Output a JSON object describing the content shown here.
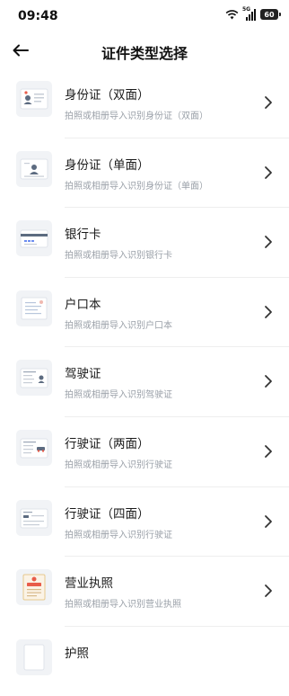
{
  "status_bar": {
    "time": "09:48",
    "network": "5G",
    "battery": "60"
  },
  "header": {
    "title": "证件类型选择"
  },
  "items": [
    {
      "title": "身份证（双面）",
      "subtitle": "拍照或相册导入识别身份证（双面）",
      "icon": "id-card-double-icon"
    },
    {
      "title": "身份证（单面）",
      "subtitle": "拍照或相册导入识别身份证（单面）",
      "icon": "id-card-single-icon"
    },
    {
      "title": "银行卡",
      "subtitle": "拍照或相册导入识别银行卡",
      "icon": "bank-card-icon"
    },
    {
      "title": "户口本",
      "subtitle": "拍照或相册导入识别户口本",
      "icon": "household-register-icon"
    },
    {
      "title": "驾驶证",
      "subtitle": "拍照或相册导入识别驾驶证",
      "icon": "driver-license-icon"
    },
    {
      "title": "行驶证（两面）",
      "subtitle": "拍照或相册导入识别行驶证",
      "icon": "vehicle-license-two-icon"
    },
    {
      "title": "行驶证（四面）",
      "subtitle": "拍照或相册导入识别行驶证",
      "icon": "vehicle-license-four-icon"
    },
    {
      "title": "营业执照",
      "subtitle": "拍照或相册导入识别营业执照",
      "icon": "business-license-icon"
    },
    {
      "title": "护照",
      "subtitle": "",
      "icon": "passport-icon"
    }
  ]
}
